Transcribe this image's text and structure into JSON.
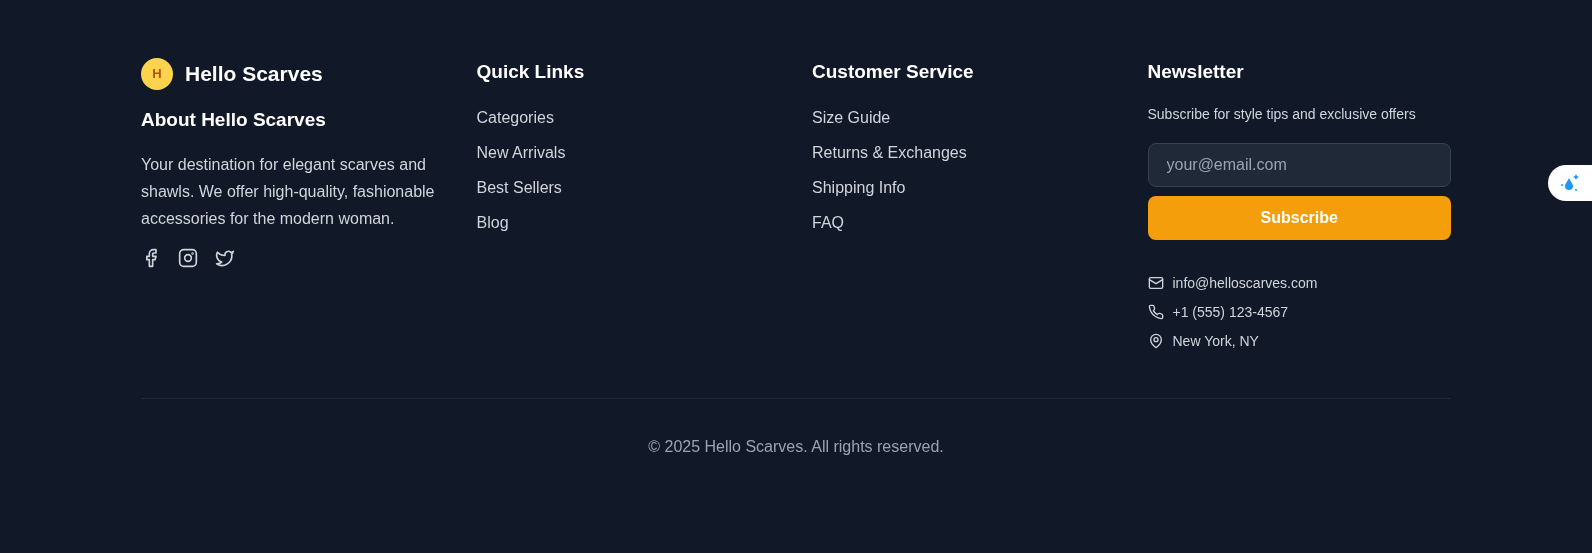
{
  "brand": {
    "logo_letter": "H",
    "name": "Hello Scarves"
  },
  "about": {
    "title": "About Hello Scarves",
    "text": "Your destination for elegant scarves and shawls. We offer high-quality, fashionable accessories for the modern woman.",
    "social": [
      {
        "kind": "facebook"
      },
      {
        "kind": "instagram"
      },
      {
        "kind": "twitter"
      }
    ]
  },
  "columns": [
    {
      "title": "Quick Links",
      "links": [
        "Categories",
        "New Arrivals",
        "Best Sellers",
        "Blog"
      ]
    },
    {
      "title": "Customer Service",
      "links": [
        "Size Guide",
        "Returns & Exchanges",
        "Shipping Info",
        "FAQ"
      ]
    }
  ],
  "newsletter": {
    "title": "Newsletter",
    "text": "Subscribe for style tips and exclusive offers",
    "placeholder": "your@email.com",
    "button": "Subscribe",
    "contacts": [
      {
        "kind": "email",
        "text": "info@helloscarves.com"
      },
      {
        "kind": "phone",
        "text": "+1 (555) 123-4567"
      },
      {
        "kind": "location",
        "text": "New York, NY"
      }
    ]
  },
  "copyright": "© 2025 Hello Scarves. All rights reserved."
}
